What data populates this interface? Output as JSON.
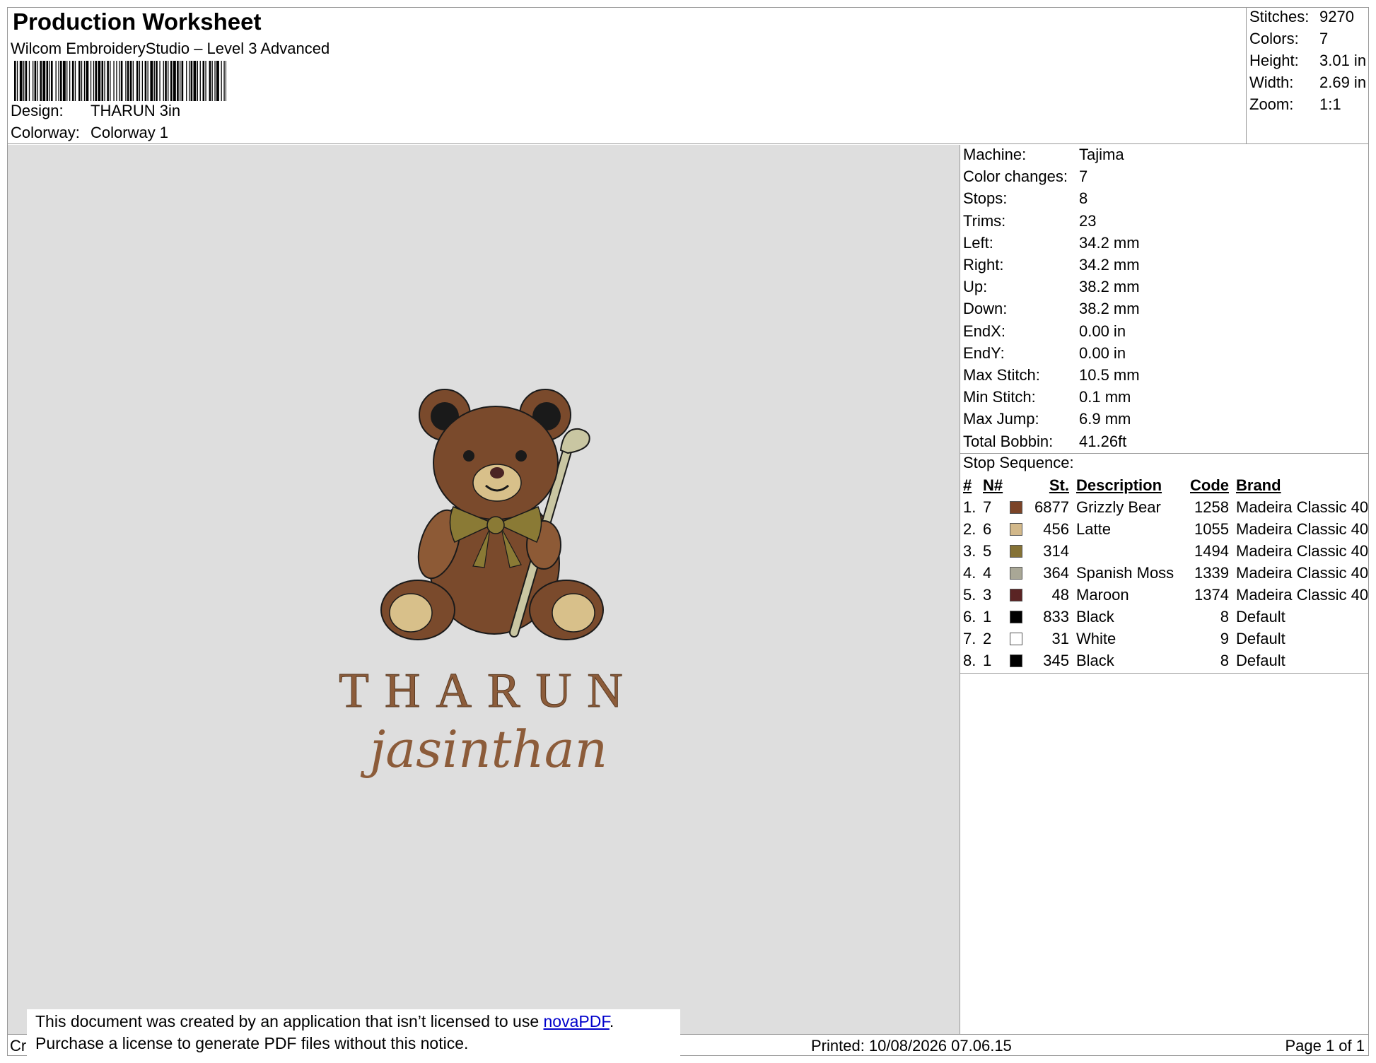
{
  "header": {
    "title": "Production Worksheet",
    "software": "Wilcom EmbroideryStudio – Level 3 Advanced",
    "design_label": "Design:",
    "design_value": "THARUN 3in",
    "colorway_label": "Colorway:",
    "colorway_value": "Colorway 1"
  },
  "stats": [
    {
      "label": "Stitches:",
      "value": "9270"
    },
    {
      "label": "Colors:",
      "value": "7"
    },
    {
      "label": "Height:",
      "value": "3.01 in"
    },
    {
      "label": "Width:",
      "value": "2.69 in"
    },
    {
      "label": "Zoom:",
      "value": "1:1"
    }
  ],
  "design_preview": {
    "text_line1": "THARUN",
    "text_line2": "jasinthan",
    "colors": {
      "fur": "#7a4a2c",
      "fur_light": "#8d5a36",
      "muzzle": "#d8c08a",
      "bow": "#8a7a35",
      "club": "#c9c6a2",
      "ear": "#1a1a1a",
      "nose": "#4a2424",
      "text": "#8c5c3a"
    }
  },
  "machine_info": [
    {
      "label": "Machine:",
      "value": "Tajima"
    },
    {
      "label": "Color changes:",
      "value": "7"
    },
    {
      "label": "Stops:",
      "value": "8"
    },
    {
      "label": "Trims:",
      "value": "23"
    },
    {
      "label": "Left:",
      "value": "34.2 mm"
    },
    {
      "label": "Right:",
      "value": "34.2 mm"
    },
    {
      "label": "Up:",
      "value": "38.2 mm"
    },
    {
      "label": "Down:",
      "value": "38.2 mm"
    },
    {
      "label": "EndX:",
      "value": "0.00 in"
    },
    {
      "label": "EndY:",
      "value": "0.00 in"
    },
    {
      "label": "Max Stitch:",
      "value": "10.5 mm"
    },
    {
      "label": "Min Stitch:",
      "value": "0.1 mm"
    },
    {
      "label": "Max Jump:",
      "value": "6.9 mm"
    },
    {
      "label": "Total Bobbin:",
      "value": "41.26ft"
    }
  ],
  "stop_sequence": {
    "title": "Stop Sequence:",
    "headers": {
      "idx": "#",
      "n": "N#",
      "st": "St.",
      "desc": "Description",
      "code": "Code",
      "brand": "Brand"
    },
    "rows": [
      {
        "idx": "1.",
        "n": "7",
        "color": "#7b4428",
        "st": "6877",
        "desc": "Grizzly Bear",
        "code": "1258",
        "brand": "Madeira Classic 40"
      },
      {
        "idx": "2.",
        "n": "6",
        "color": "#d2b88a",
        "st": "456",
        "desc": "Latte",
        "code": "1055",
        "brand": "Madeira Classic 40"
      },
      {
        "idx": "3.",
        "n": "5",
        "color": "#857236",
        "st": "314",
        "desc": "",
        "code": "1494",
        "brand": "Madeira Classic 40"
      },
      {
        "idx": "4.",
        "n": "4",
        "color": "#a9a796",
        "st": "364",
        "desc": "Spanish Moss",
        "code": "1339",
        "brand": "Madeira Classic 40"
      },
      {
        "idx": "5.",
        "n": "3",
        "color": "#5a2424",
        "st": "48",
        "desc": "Maroon",
        "code": "1374",
        "brand": "Madeira Classic 40"
      },
      {
        "idx": "6.",
        "n": "1",
        "color": "#000000",
        "st": "833",
        "desc": "Black",
        "code": "8",
        "brand": "Default"
      },
      {
        "idx": "7.",
        "n": "2",
        "color": "#ffffff",
        "st": "31",
        "desc": "White",
        "code": "9",
        "brand": "Default"
      },
      {
        "idx": "8.",
        "n": "1",
        "color": "#000000",
        "st": "345",
        "desc": "Black",
        "code": "8",
        "brand": "Default"
      }
    ]
  },
  "footer": {
    "created": "Cr",
    "printed": "Printed: 10/08/2026 07.06.15",
    "page": "Page 1 of 1"
  },
  "notice": {
    "line1_prefix": "This document was created by an application that isn’t licensed to use ",
    "link": "novaPDF",
    "line1_suffix": ".",
    "line2": "Purchase a license to generate PDF files without this notice."
  }
}
